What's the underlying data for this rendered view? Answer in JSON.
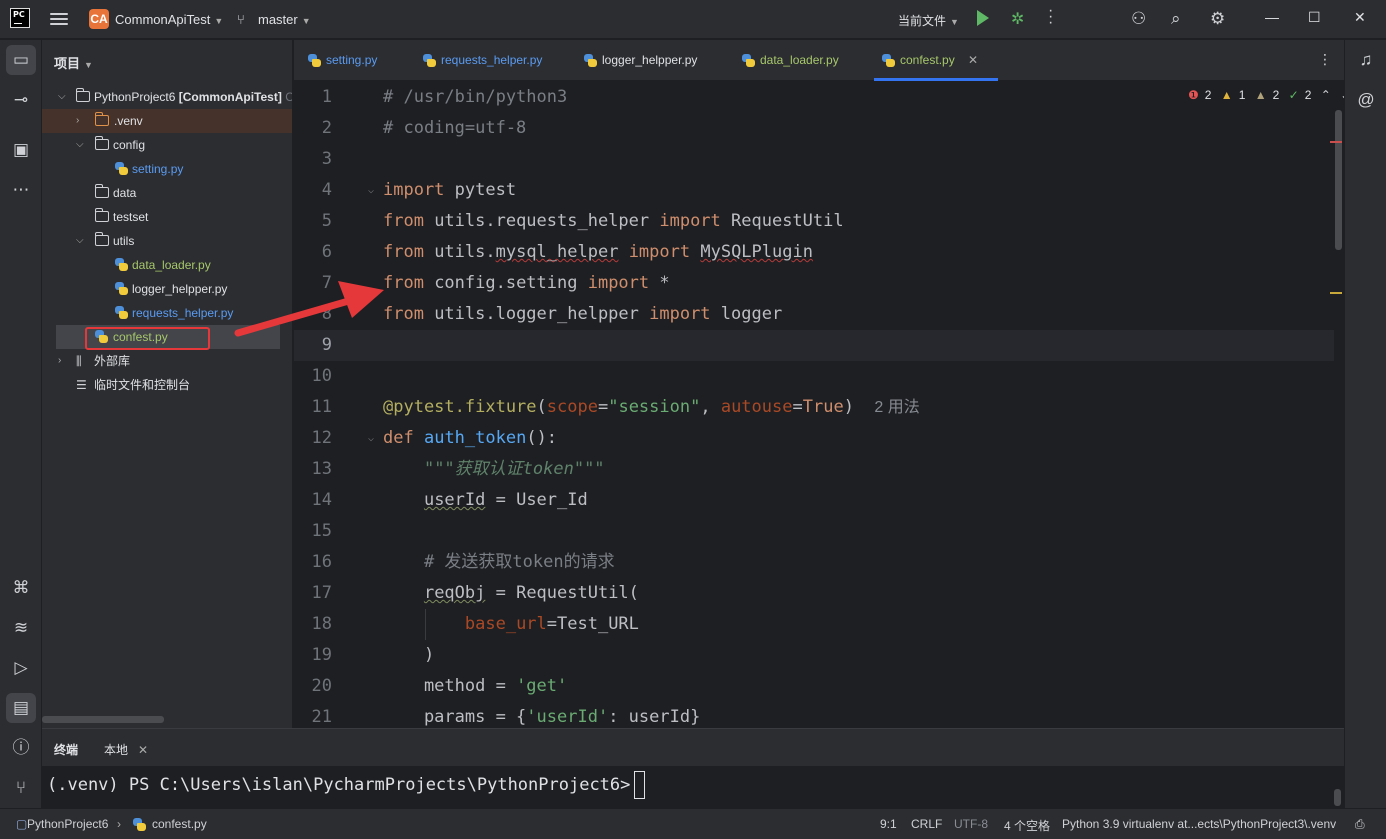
{
  "titlebar": {
    "logo": "PC",
    "project_badge": "CA",
    "project_name": "CommonApiTest",
    "branch": "master",
    "run_config": "当前文件"
  },
  "project_panel": {
    "header": "项目",
    "tree": [
      {
        "label": "PythonProject6",
        "bold_suffix": "[CommonApiTest]",
        "extra": "C:"
      },
      {
        "label": ".venv"
      },
      {
        "label": "config"
      },
      {
        "label": "setting.py"
      },
      {
        "label": "data"
      },
      {
        "label": "testset"
      },
      {
        "label": "utils"
      },
      {
        "label": "data_loader.py"
      },
      {
        "label": "logger_helpper.py"
      },
      {
        "label": "requests_helper.py"
      },
      {
        "label": "confest.py"
      },
      {
        "label": "外部库"
      },
      {
        "label": "临时文件和控制台"
      }
    ]
  },
  "tabs": [
    {
      "label": "setting.py"
    },
    {
      "label": "requests_helper.py"
    },
    {
      "label": "logger_helpper.py"
    },
    {
      "label": "data_loader.py"
    },
    {
      "label": "confest.py",
      "active": true
    }
  ],
  "inspections": {
    "errors": "2",
    "warnings": "1",
    "weak_warnings": "2",
    "ok": "2"
  },
  "editor": {
    "line_numbers": [
      "1",
      "2",
      "3",
      "4",
      "5",
      "6",
      "7",
      "8",
      "9",
      "10",
      "11",
      "12",
      "13",
      "14",
      "15",
      "16",
      "17",
      "18",
      "19",
      "20",
      "21"
    ],
    "usages_hint": "2 用法"
  },
  "terminal": {
    "title": "终端",
    "tab": "本地",
    "prompt": "(.venv) PS C:\\Users\\islan\\PycharmProjects\\PythonProject6>"
  },
  "statusbar": {
    "breadcrumb_project": "PythonProject6",
    "breadcrumb_file": "confest.py",
    "position": "9:1",
    "line_sep": "CRLF",
    "encoding": "UTF-8",
    "indent": "4 个空格",
    "interpreter": "Python 3.9 virtualenv at...ects\\PythonProject3\\.venv"
  },
  "colors": {
    "accent": "#3574f0",
    "annotation": "#e5383b",
    "run": "#5fb865"
  }
}
